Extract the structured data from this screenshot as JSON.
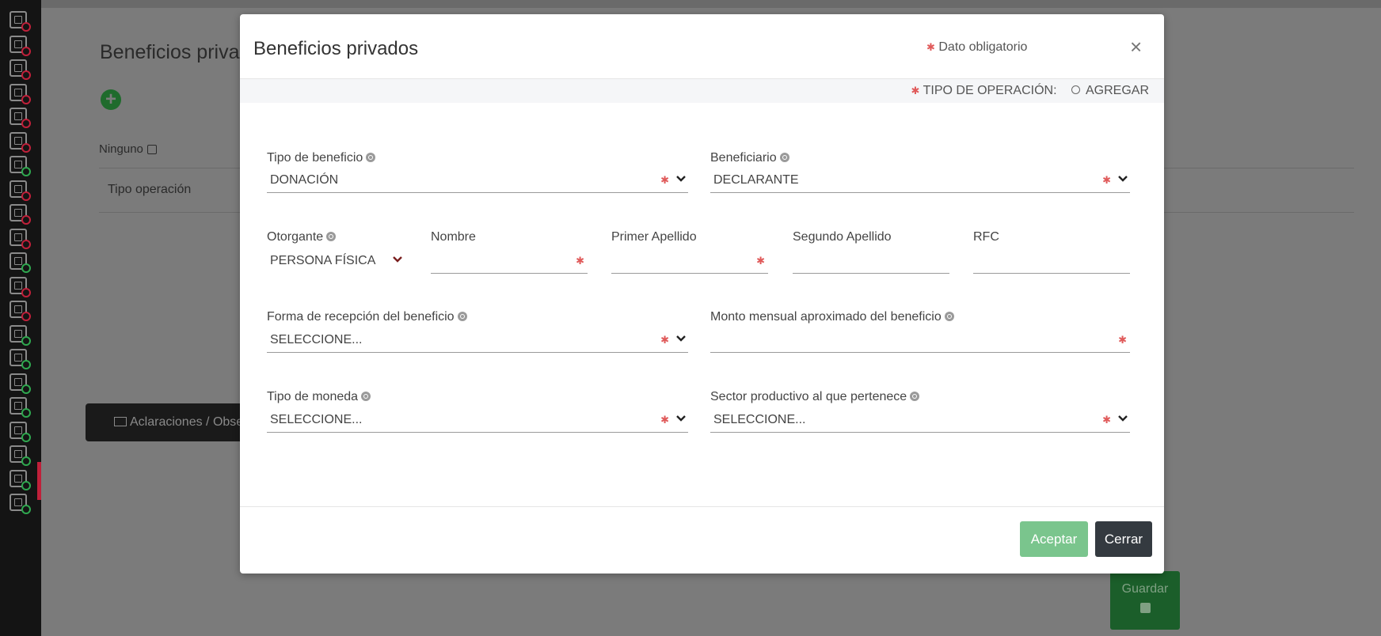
{
  "colors": {
    "accent_green": "#7ac58d",
    "dark_button": "#343a40",
    "required_star": "#e05a5a",
    "sidebar_bg": "#141414",
    "status_red": "#c0203a",
    "status_green": "#2fa84f"
  },
  "sidebar": {
    "items": [
      {
        "icon": "id-card-icon",
        "status": "red"
      },
      {
        "icon": "house-money-icon",
        "status": "red"
      },
      {
        "icon": "document-icon",
        "status": "red"
      },
      {
        "icon": "building-icon",
        "status": "red"
      },
      {
        "icon": "people-link-icon",
        "status": "red"
      },
      {
        "icon": "family-icon",
        "status": "red"
      },
      {
        "icon": "form-edit-icon",
        "status": "green"
      },
      {
        "icon": "search-person-icon",
        "status": "red"
      },
      {
        "icon": "home-icon",
        "status": "red"
      },
      {
        "icon": "car-icon",
        "status": "red"
      },
      {
        "icon": "chart-line-icon",
        "status": "green"
      },
      {
        "icon": "hands-icon",
        "status": "red"
      },
      {
        "icon": "desk-icon",
        "status": "red"
      },
      {
        "icon": "house-gear-icon",
        "status": "green"
      },
      {
        "icon": "pie-chart-icon",
        "status": "green"
      },
      {
        "icon": "network-icon",
        "status": "green"
      },
      {
        "icon": "group-umbrella-icon",
        "status": "green"
      },
      {
        "icon": "organization-icon",
        "status": "green"
      },
      {
        "icon": "trend-chart-icon",
        "status": "green"
      },
      {
        "icon": "person-group-icon",
        "status": "green",
        "active": true
      },
      {
        "icon": "checklist-icon",
        "status": "green"
      }
    ]
  },
  "page": {
    "title": "Beneficios privados",
    "ninguno_label": "Ninguno",
    "column_header": "Tipo operación",
    "observaciones_label": "Aclaraciones / Observaciones",
    "guardar_label": "Guardar"
  },
  "modal": {
    "title": "Beneficios privados",
    "required_note": "Dato obligatorio",
    "close_symbol": "×",
    "operation_label": "TIPO DE OPERACIÓN:",
    "operation_option": "AGREGAR",
    "fields": {
      "tipo_beneficio": {
        "label": "Tipo de beneficio",
        "value": "DONACIÓN"
      },
      "beneficiario": {
        "label": "Beneficiario",
        "value": "DECLARANTE"
      },
      "otorgante": {
        "label": "Otorgante",
        "value": "PERSONA FÍSICA"
      },
      "nombre": {
        "label": "Nombre",
        "value": ""
      },
      "primer_apellido": {
        "label": "Primer Apellido",
        "value": ""
      },
      "segundo_apellido": {
        "label": "Segundo Apellido",
        "value": ""
      },
      "rfc": {
        "label": "RFC",
        "value": ""
      },
      "forma_recepcion": {
        "label": "Forma de recepción del beneficio",
        "value": "SELECCIONE..."
      },
      "monto_mensual": {
        "label": "Monto mensual aproximado del beneficio",
        "value": ""
      },
      "tipo_moneda": {
        "label": "Tipo de moneda",
        "value": "SELECCIONE..."
      },
      "sector_productivo": {
        "label": "Sector productivo al que pertenece",
        "value": "SELECCIONE..."
      }
    },
    "accept_label": "Aceptar",
    "close_label": "Cerrar"
  }
}
